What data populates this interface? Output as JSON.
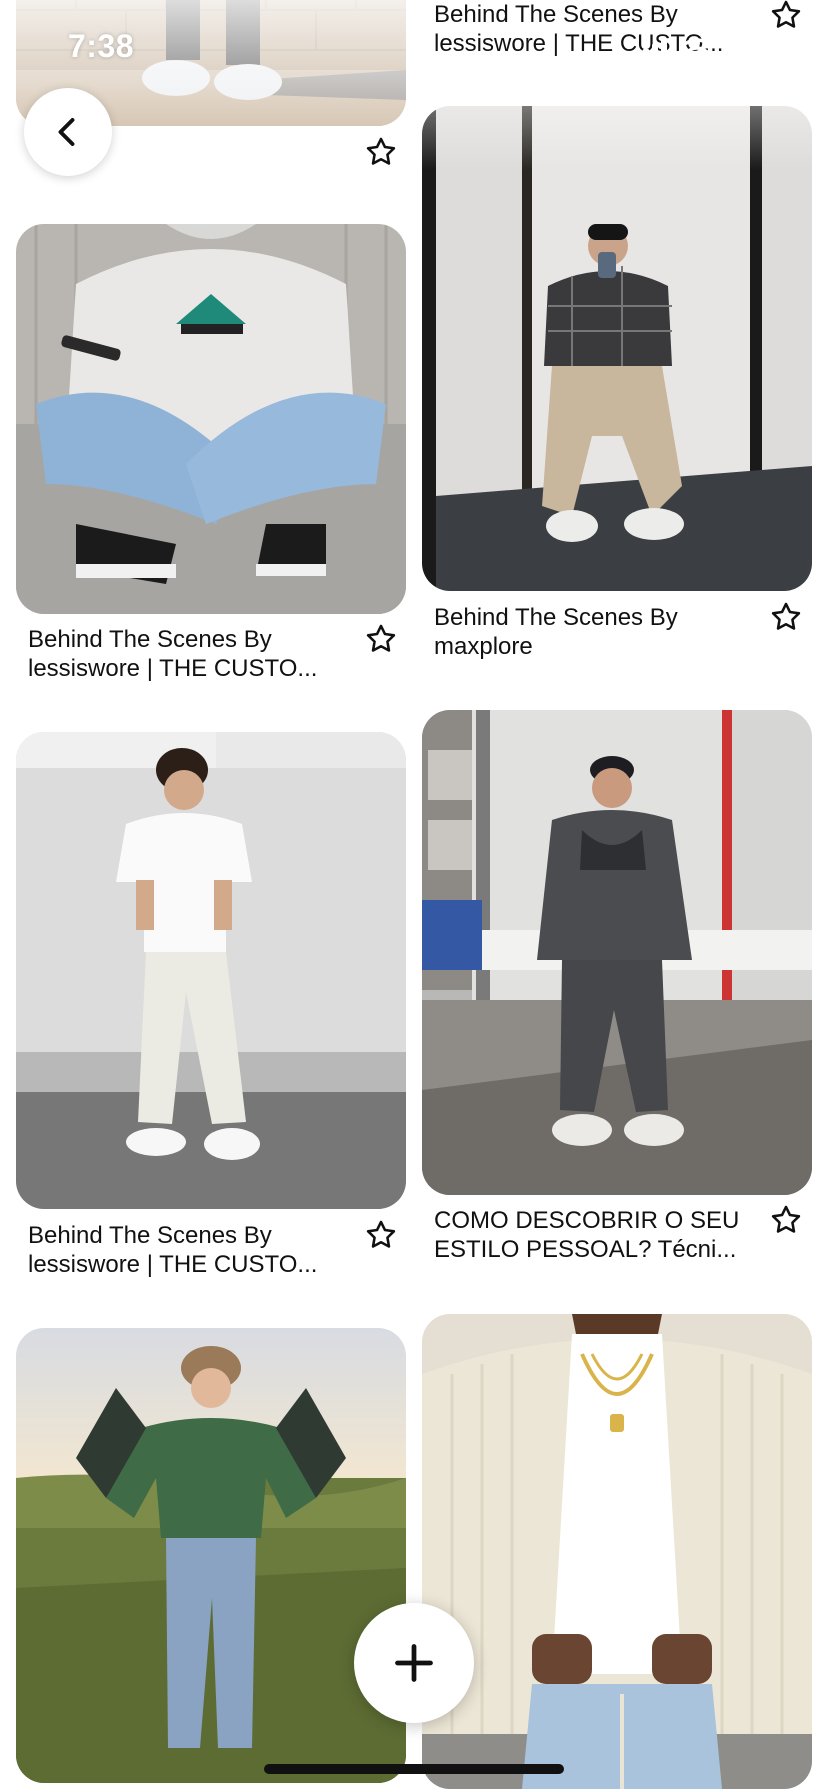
{
  "status_bar": {
    "time": "7:38"
  },
  "navigation": {
    "back_icon": "chevron-left-icon"
  },
  "pins": [
    {
      "title_line1": "Behind The Scenes By",
      "title_line2": "lessiswore | THE CUSTO..."
    },
    {
      "title_line1": "Behind The Scenes By",
      "title_line2": "lessiswore | THE CUSTO..."
    },
    {
      "title_line1": "Behind The Scenes By",
      "title_line2": "maxplore"
    },
    {
      "title_line1": "Behind The Scenes By",
      "title_line2": "lessiswore | THE CUSTO..."
    },
    {
      "title_line1": "COMO DESCOBRIR O SEU",
      "title_line2": "ESTILO PESSOAL? Técni..."
    },
    {
      "title_line1": "",
      "title_line2": ""
    },
    {
      "title_line1": "",
      "title_line2": ""
    }
  ],
  "fab": {
    "icon": "plus-icon"
  },
  "colors": {
    "text": "#111111",
    "background": "#ffffff"
  }
}
